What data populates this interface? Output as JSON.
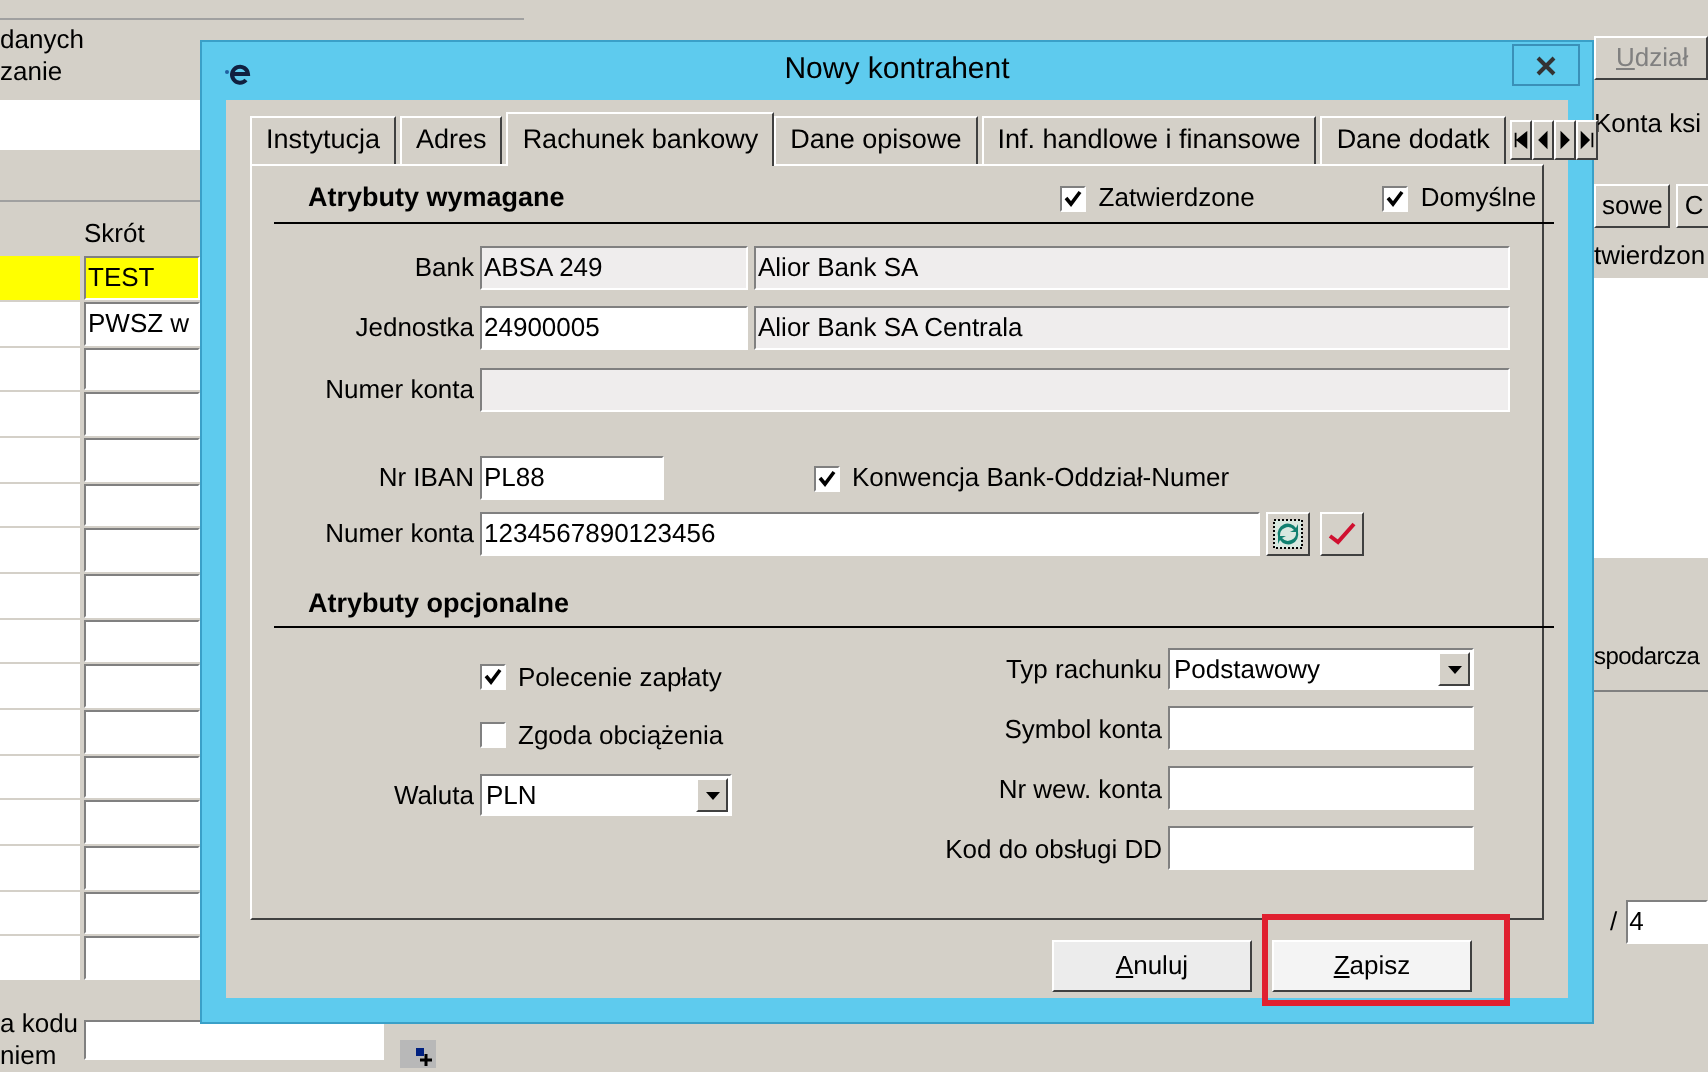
{
  "background": {
    "left_panel": {
      "texts": [
        "danych",
        "zanie"
      ],
      "grid": {
        "columns": [
          "Skrót"
        ],
        "rows": [
          {
            "cell": "TEST",
            "selected": true
          },
          {
            "cell": "PWSZ w",
            "selected": false
          },
          {
            "cell": "",
            "selected": false
          }
        ]
      },
      "bottom_label": [
        "a kodu",
        "niem"
      ]
    },
    "right_panel": {
      "button": "Udział",
      "texts": [
        "Konta ksi"
      ],
      "tabs": [
        "sowe",
        "C"
      ],
      "column": "twierdzon",
      "section": "spodarcza",
      "slash": "/",
      "value": "4"
    }
  },
  "dialog": {
    "title": "Nowy kontrahent",
    "tabs": [
      {
        "label": "Instytucja",
        "selected": false
      },
      {
        "label": "Adres",
        "selected": false
      },
      {
        "label": "Rachunek bankowy",
        "selected": true
      },
      {
        "label": "Dane opisowe",
        "selected": false
      },
      {
        "label": "Inf. handlowe i finansowe",
        "selected": false
      },
      {
        "label": "Dane dodatk",
        "selected": false
      }
    ],
    "required": {
      "heading": "Atrybuty wymagane",
      "flags": [
        {
          "label": "Zatwierdzone",
          "checked": true
        },
        {
          "label": "Domyślne",
          "checked": true
        }
      ],
      "bank": {
        "label": "Bank",
        "code": "ABSA 249",
        "name": "Alior Bank SA"
      },
      "unit": {
        "label": "Jednostka",
        "code": "24900005",
        "name": "Alior Bank SA Centrala"
      },
      "account_number": {
        "label": "Numer konta"
      },
      "iban": {
        "label": "Nr IBAN",
        "value": "PL88"
      },
      "convention": {
        "label": "Konwencja Bank-Oddział-Numer",
        "checked": true
      },
      "account": {
        "label": "Numer konta",
        "value": "1234567890123456"
      }
    },
    "optional": {
      "heading": "Atrybuty opcjonalne",
      "checks": [
        {
          "label": "Polecenie zapłaty",
          "checked": true
        },
        {
          "label": "Zgoda obciążenia",
          "checked": false
        }
      ],
      "currency": {
        "label": "Waluta",
        "value": "PLN"
      },
      "fields": [
        {
          "label": "Typ rachunku",
          "value": "Podstawowy",
          "kind": "select"
        },
        {
          "label": "Symbol konta",
          "kind": "text"
        },
        {
          "label": "Nr wew. konta",
          "kind": "text"
        },
        {
          "label": "Kod do obsługi DD",
          "kind": "text"
        }
      ]
    },
    "buttons": [
      {
        "label": "Anuluj",
        "mnemonic": true,
        "highlighted": false
      },
      {
        "label": "Zapisz",
        "mnemonic": true,
        "highlighted": true
      }
    ]
  }
}
